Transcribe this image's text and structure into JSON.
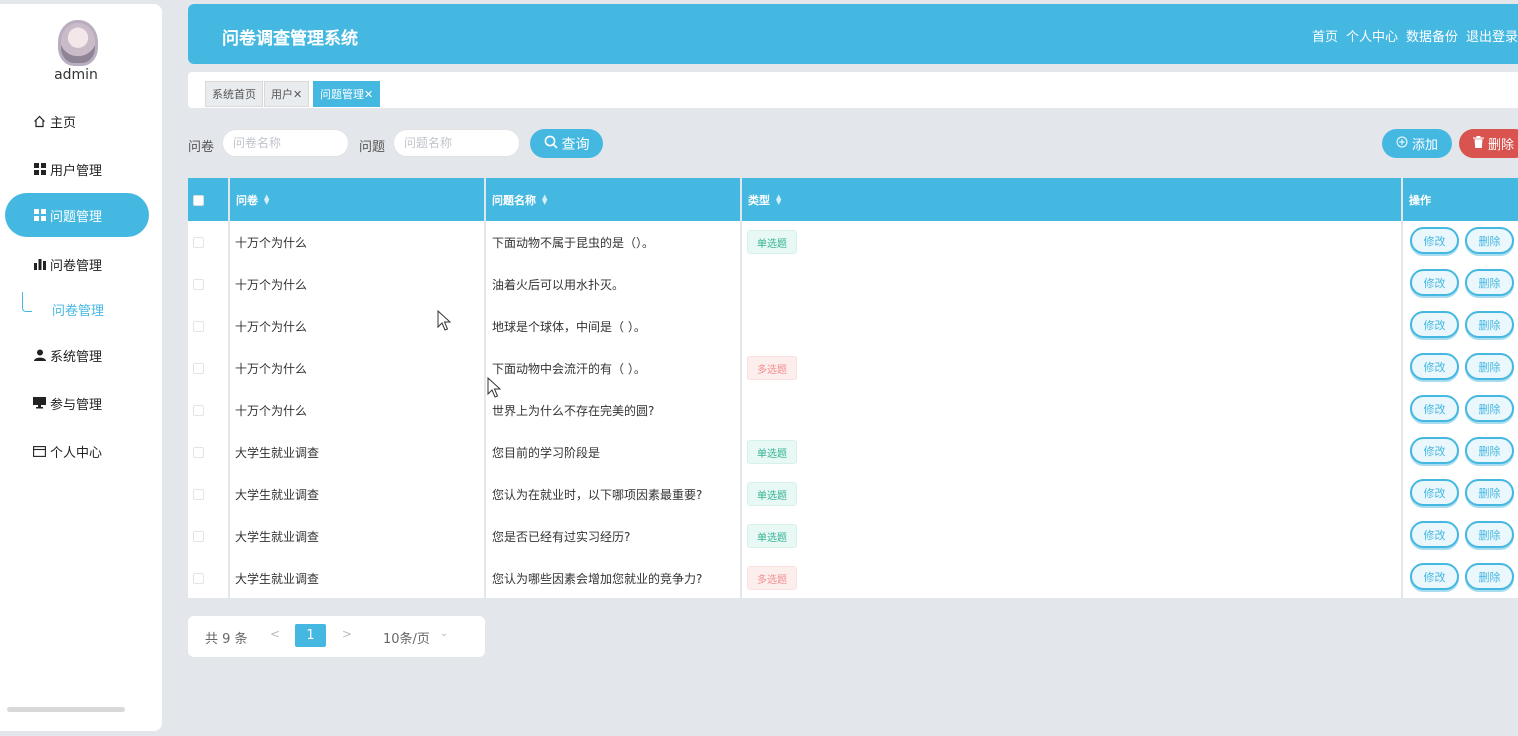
{
  "sidebar": {
    "username": "admin",
    "items": [
      {
        "label": "主页",
        "icon": "home-icon"
      },
      {
        "label": "用户管理",
        "icon": "grid-icon"
      },
      {
        "label": "问题管理",
        "icon": "grid-icon",
        "active": true
      },
      {
        "label": "问卷管理",
        "icon": "bar-chart-icon"
      },
      {
        "label": "系统管理",
        "icon": "user-icon"
      },
      {
        "label": "参与管理",
        "icon": "monitor-icon"
      },
      {
        "label": "个人中心",
        "icon": "card-icon"
      }
    ],
    "submenu_label": "问卷管理"
  },
  "header": {
    "title": "问卷调查管理系统",
    "nav": [
      "首页",
      "个人中心",
      "数据备份",
      "退出登录"
    ]
  },
  "tabs": [
    {
      "label": "系统首页"
    },
    {
      "label": "用户✕"
    },
    {
      "label": "问题管理✕",
      "active": true
    }
  ],
  "search": {
    "survey_label": "问卷",
    "survey_placeholder": "问卷名称",
    "question_label": "问题",
    "question_placeholder": "问题名称",
    "query_label": "查询",
    "add_label": "添加",
    "delete_label": "删除"
  },
  "table": {
    "headers": [
      "问卷",
      "问题名称",
      "类型",
      "操作"
    ],
    "edit_label": "修改",
    "delete_label": "删除",
    "rows": [
      {
        "survey": "十万个为什么",
        "question": "下面动物不属于昆虫的是（）。",
        "type": "单选题",
        "type_kind": "single"
      },
      {
        "survey": "十万个为什么",
        "question": "油着火后可以用水扑灭。",
        "type": "",
        "type_kind": ""
      },
      {
        "survey": "十万个为什么",
        "question": "地球是个球体，中间是（ ）。",
        "type": "",
        "type_kind": ""
      },
      {
        "survey": "十万个为什么",
        "question": "下面动物中会流汗的有（ ）。",
        "type": "多选题",
        "type_kind": "multi"
      },
      {
        "survey": "十万个为什么",
        "question": "世界上为什么不存在完美的圆?",
        "type": "",
        "type_kind": ""
      },
      {
        "survey": "大学生就业调查",
        "question": "您目前的学习阶段是",
        "type": "单选题",
        "type_kind": "single"
      },
      {
        "survey": "大学生就业调查",
        "question": "您认为在就业时，以下哪项因素最重要?",
        "type": "单选题",
        "type_kind": "single"
      },
      {
        "survey": "大学生就业调查",
        "question": "您是否已经有过实习经历?",
        "type": "单选题",
        "type_kind": "single"
      },
      {
        "survey": "大学生就业调查",
        "question": "您认为哪些因素会增加您就业的竞争力?",
        "type": "多选题",
        "type_kind": "multi"
      }
    ]
  },
  "pagination": {
    "total": "共 9 条",
    "prev": "<",
    "current": "1",
    "next": ">",
    "page_size": "10条/页"
  },
  "colors": {
    "primary": "#45b8e2",
    "danger": "#d9534f",
    "background": "#e3e6ea"
  }
}
